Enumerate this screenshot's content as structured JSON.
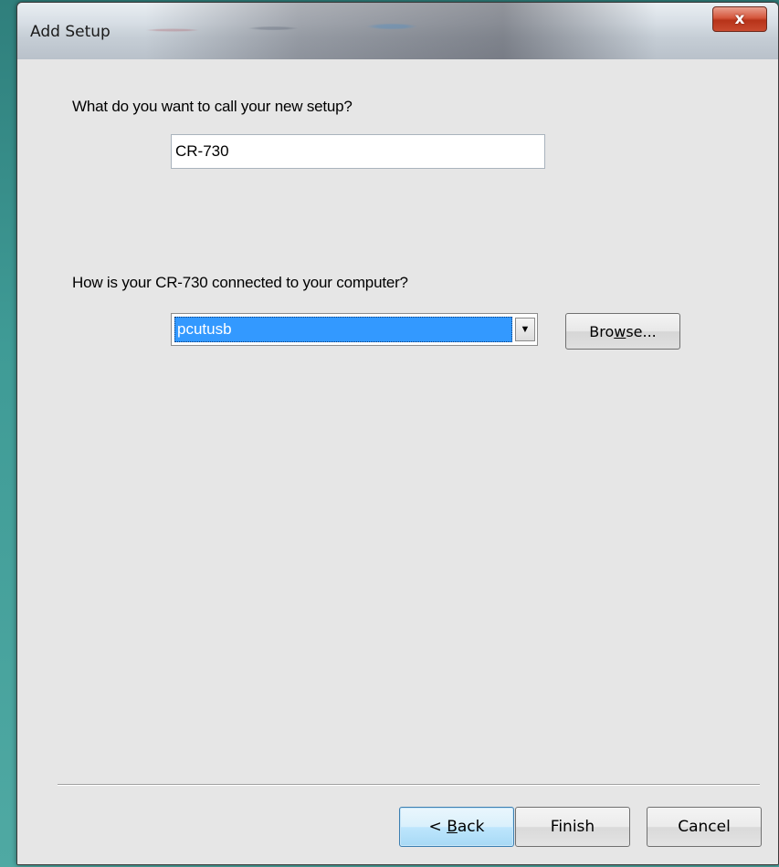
{
  "window": {
    "title": "Add Setup",
    "close_label": "x"
  },
  "form": {
    "question_name": "What do you want to call your new setup?",
    "setup_name_value": "CR-730",
    "question_connection": "How is your CR-730 connected to your computer?",
    "connection_selected": "pcutusb",
    "browse_label_pre": "Bro",
    "browse_label_accel": "w",
    "browse_label_post": "se..."
  },
  "footer": {
    "back_pre": "< ",
    "back_accel": "B",
    "back_post": "ack",
    "finish_label": "Finish",
    "cancel_label": "Cancel"
  },
  "colors": {
    "selection": "#3399ff",
    "desktop": "#3f9b96",
    "close_button": "#c94a2f"
  },
  "icons": {
    "close": "close-icon",
    "dropdown": "chevron-down-icon"
  }
}
